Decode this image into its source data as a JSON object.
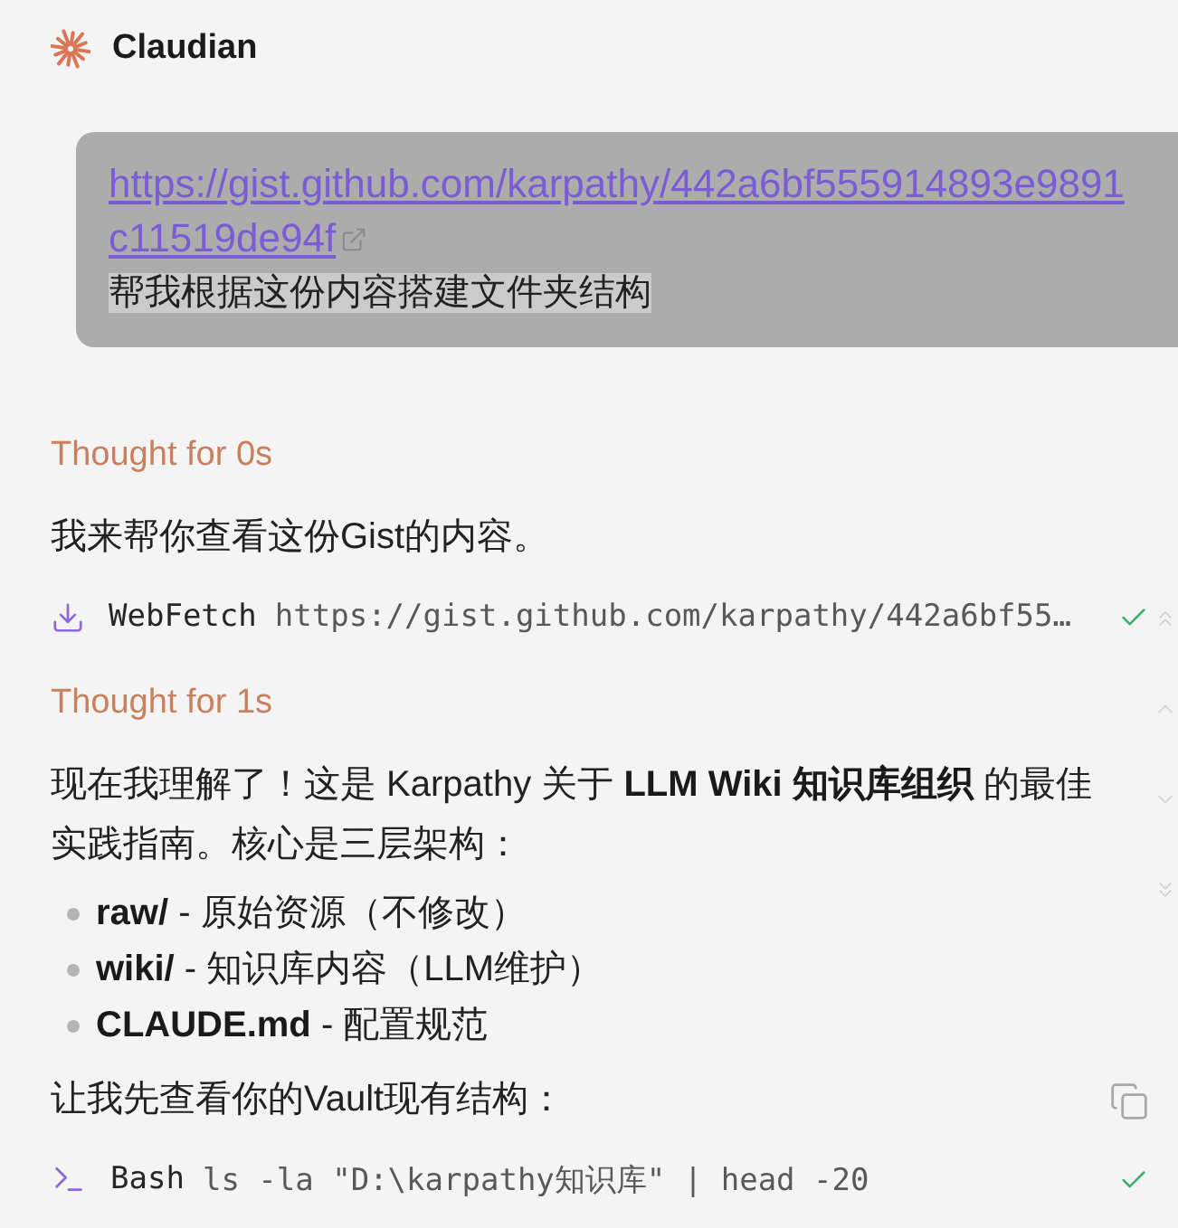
{
  "header": {
    "title": "Claudian"
  },
  "messages": [
    {
      "kind": "user",
      "link": "https://gist.github.com/karpathy/442a6bf555914893e9891c11519de94f",
      "text": "帮我根据这份内容搭建文件夹结构",
      "highlighted": true
    },
    {
      "kind": "thought",
      "text": "Thought for 0s"
    },
    {
      "kind": "paragraph",
      "text": "我来帮你查看这份Gist的内容。",
      "copy": false
    },
    {
      "kind": "fetch",
      "tool": "WebFetch",
      "command": "https://gist.github.com/karpathy/442a6bf55…",
      "done": true
    },
    {
      "kind": "thought",
      "text": "Thought for 1s"
    },
    {
      "kind": "paragraph",
      "text": "现在我理解了！这是 Karpathy 关于 **LLM Wiki 知识库组织** 的最佳实践指南。核心是三层架构：",
      "copy": false
    },
    {
      "kind": "list",
      "items": [
        "**raw/** - 原始资源（不修改）",
        "**wiki/** - 知识库内容（LLM维护）",
        "**CLAUDE.md** - 配置规范"
      ]
    },
    {
      "kind": "paragraph",
      "text": "让我先查看你的Vault现有结构：",
      "copy": true
    },
    {
      "kind": "bash",
      "tool": "Bash",
      "command": "ls -la \"D:\\karpathy知识库\" | head -20",
      "done": true
    }
  ]
}
